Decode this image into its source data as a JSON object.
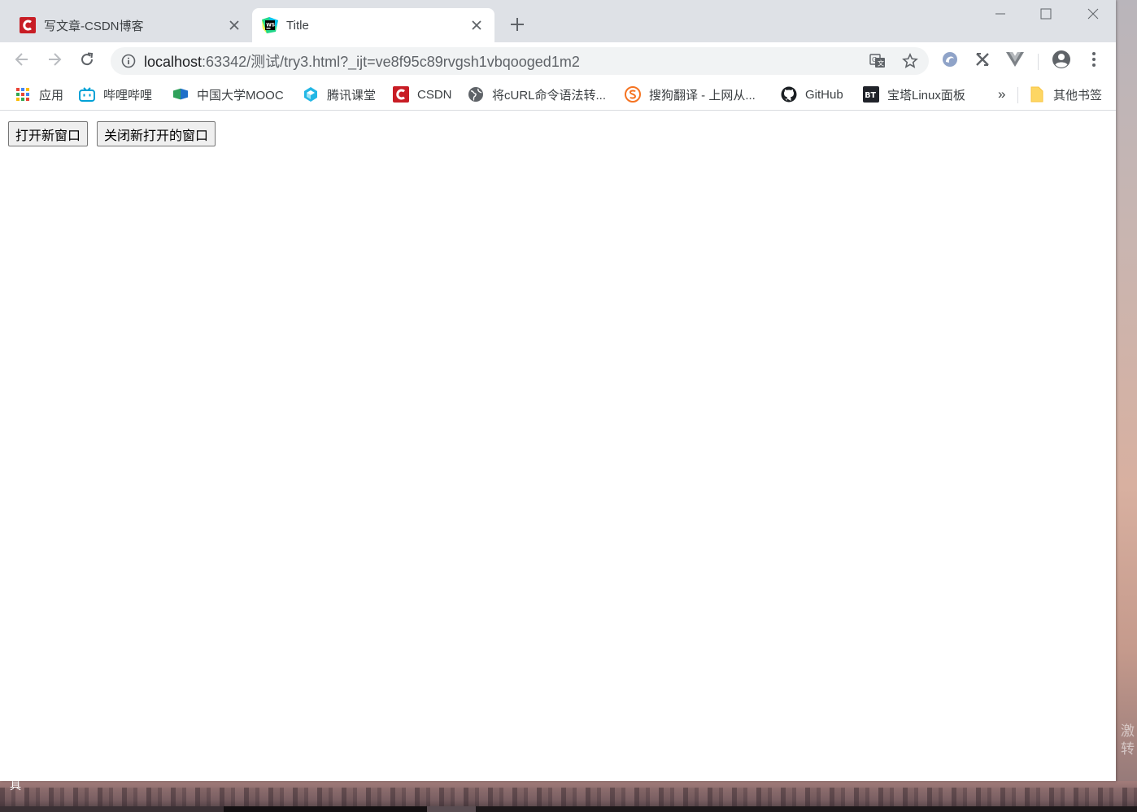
{
  "tabs": [
    {
      "title": "写文章-CSDN博客",
      "icon": "csdn-icon",
      "active": false
    },
    {
      "title": "Title",
      "icon": "webstorm-icon",
      "active": true
    }
  ],
  "toolbar": {
    "url_host": "localhost",
    "url_rest": ":63342/测试/try3.html?_ijt=ve8f95c89rvgsh1vbqooged1m2"
  },
  "bookmarks": [
    {
      "label": "应用",
      "icon": "apps-grid-icon"
    },
    {
      "label": "哔哩哔哩",
      "icon": "bilibili-icon"
    },
    {
      "label": "中国大学MOOC",
      "icon": "mooc-icon"
    },
    {
      "label": "腾讯课堂",
      "icon": "tencent-classroom-icon"
    },
    {
      "label": "CSDN",
      "icon": "csdn-icon"
    },
    {
      "label": "将cURL命令语法转...",
      "icon": "globe-icon"
    },
    {
      "label": "搜狗翻译 - 上网从...",
      "icon": "sogou-icon"
    },
    {
      "label": "GitHub",
      "icon": "github-icon"
    },
    {
      "label": "宝塔Linux面板",
      "icon": "bt-icon"
    },
    {
      "label": "其他书签",
      "icon": "folder-icon"
    }
  ],
  "bookmarks_overflow": "»",
  "bt_badge": "BT",
  "page": {
    "open_button": "打开新窗口",
    "close_button": "关闭新打开的窗口"
  },
  "desktop": {
    "corner_glyph": "具",
    "side_text": "激转"
  },
  "colors": {
    "tabstrip": "#dee1e6",
    "csdn_red": "#c81d25",
    "omnibox": "#f1f3f4"
  }
}
